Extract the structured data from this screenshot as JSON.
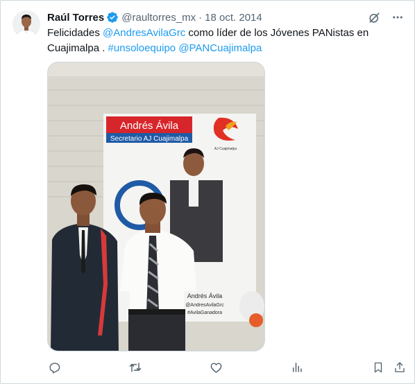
{
  "tweet": {
    "author_name": "Raúl Torres",
    "handle": "@raultorres_mx",
    "separator": "·",
    "date": "18 oct. 2014",
    "text_segments": [
      {
        "type": "text",
        "value": "Felicidades "
      },
      {
        "type": "mention",
        "value": "@AndresAvilaGrc"
      },
      {
        "type": "text",
        "value": " como líder de los Jóvenes PANistas en Cuajimalpa . "
      },
      {
        "type": "hashtag",
        "value": "#unsoloequipo"
      },
      {
        "type": "text",
        "value": " "
      },
      {
        "type": "mention",
        "value": "@PANCuajimalpa"
      }
    ]
  },
  "media": {
    "banner_title": "Andrés Ávila",
    "banner_subtitle": "Secretario AJ Cuajimalpa",
    "logo_caption": "AJ Cuajimalpa",
    "poster_name": "Andrés Ávila",
    "poster_handle": "@AndresAvilaGrc",
    "poster_hashtag": "#AvilaGanadora"
  },
  "icons": {
    "verified": "verified-badge-icon",
    "grok": "grok-icon",
    "more": "more-options-icon",
    "reply": "reply-icon",
    "retweet": "retweet-icon",
    "like": "like-icon",
    "views": "views-icon",
    "bookmark": "bookmark-icon",
    "share": "share-icon"
  },
  "colors": {
    "link": "#1d9bf0",
    "verified": "#1d9bf0",
    "text": "#0f1419",
    "muted": "#536471"
  }
}
